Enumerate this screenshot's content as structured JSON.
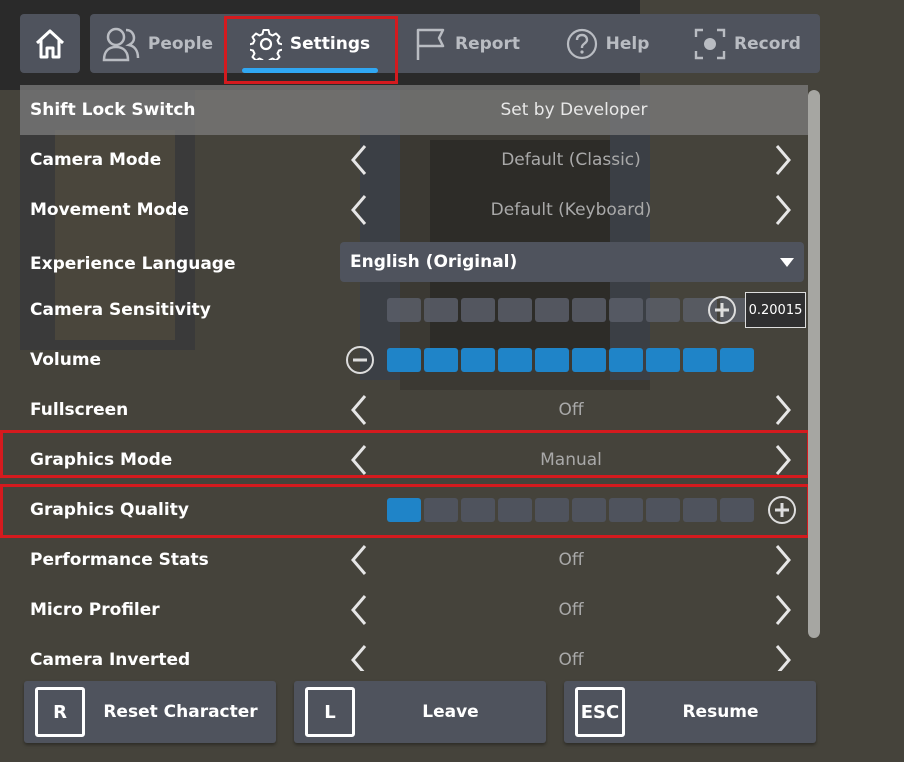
{
  "nav": {
    "home_icon": "home-icon",
    "tabs": [
      {
        "label": "People",
        "icon": "people-icon",
        "active": false
      },
      {
        "label": "Settings",
        "icon": "gear-icon",
        "active": true
      },
      {
        "label": "Report",
        "icon": "flag-icon",
        "active": false
      },
      {
        "label": "Help",
        "icon": "question-circle-icon",
        "active": false
      },
      {
        "label": "Record",
        "icon": "record-icon",
        "active": false
      }
    ],
    "active_underline_color": "#30a7f2"
  },
  "settings": {
    "shift_lock": {
      "label": "Shift Lock Switch",
      "value": "Set by Developer"
    },
    "camera_mode": {
      "label": "Camera Mode",
      "value": "Default (Classic)"
    },
    "movement_mode": {
      "label": "Movement Mode",
      "value": "Default (Keyboard)"
    },
    "experience_language": {
      "label": "Experience Language",
      "value": "English (Original)"
    },
    "camera_sensitivity": {
      "label": "Camera Sensitivity",
      "value": "0.20015",
      "filled_segments": 0,
      "total_segments": 10
    },
    "volume": {
      "label": "Volume",
      "filled_segments": 10,
      "total_segments": 10
    },
    "fullscreen": {
      "label": "Fullscreen",
      "value": "Off"
    },
    "graphics_mode": {
      "label": "Graphics Mode",
      "value": "Manual"
    },
    "graphics_quality": {
      "label": "Graphics Quality",
      "filled_segments": 1,
      "total_segments": 10
    },
    "performance_stats": {
      "label": "Performance Stats",
      "value": "Off"
    },
    "micro_profiler": {
      "label": "Micro Profiler",
      "value": "Off"
    },
    "camera_inverted": {
      "label": "Camera Inverted",
      "value": "Off"
    }
  },
  "actions": {
    "reset": {
      "key": "R",
      "label": "Reset Character"
    },
    "leave": {
      "key": "L",
      "label": "Leave"
    },
    "resume": {
      "key": "ESC",
      "label": "Resume"
    }
  },
  "colors": {
    "accent_blue": "#1f84c8",
    "highlight_red": "#d41a1e",
    "panel": "#4f535d"
  }
}
